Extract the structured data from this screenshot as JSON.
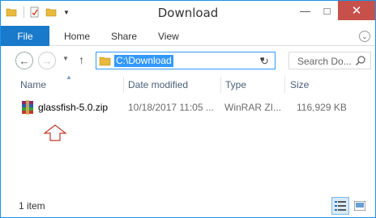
{
  "window": {
    "title": "Download"
  },
  "ribbon": {
    "tabs": [
      "File",
      "Home",
      "Share",
      "View"
    ]
  },
  "address_bar": {
    "path": "C:\\Download",
    "search_placeholder": "Search Do..."
  },
  "columns": [
    "Name",
    "Date modified",
    "Type",
    "Size"
  ],
  "files": [
    {
      "name": "glassfish-5.0.zip",
      "date_modified": "10/18/2017 11:05 ...",
      "type": "WinRAR ZI...",
      "size": "116,929 KB",
      "icon": "winrar-archive-icon"
    }
  ],
  "status_bar": {
    "item_count": "1 item"
  },
  "colors": {
    "accent": "#1979ca",
    "close_button": "#c7504a",
    "selection": "#3399ff",
    "annotation_arrow": "#c0392b"
  }
}
